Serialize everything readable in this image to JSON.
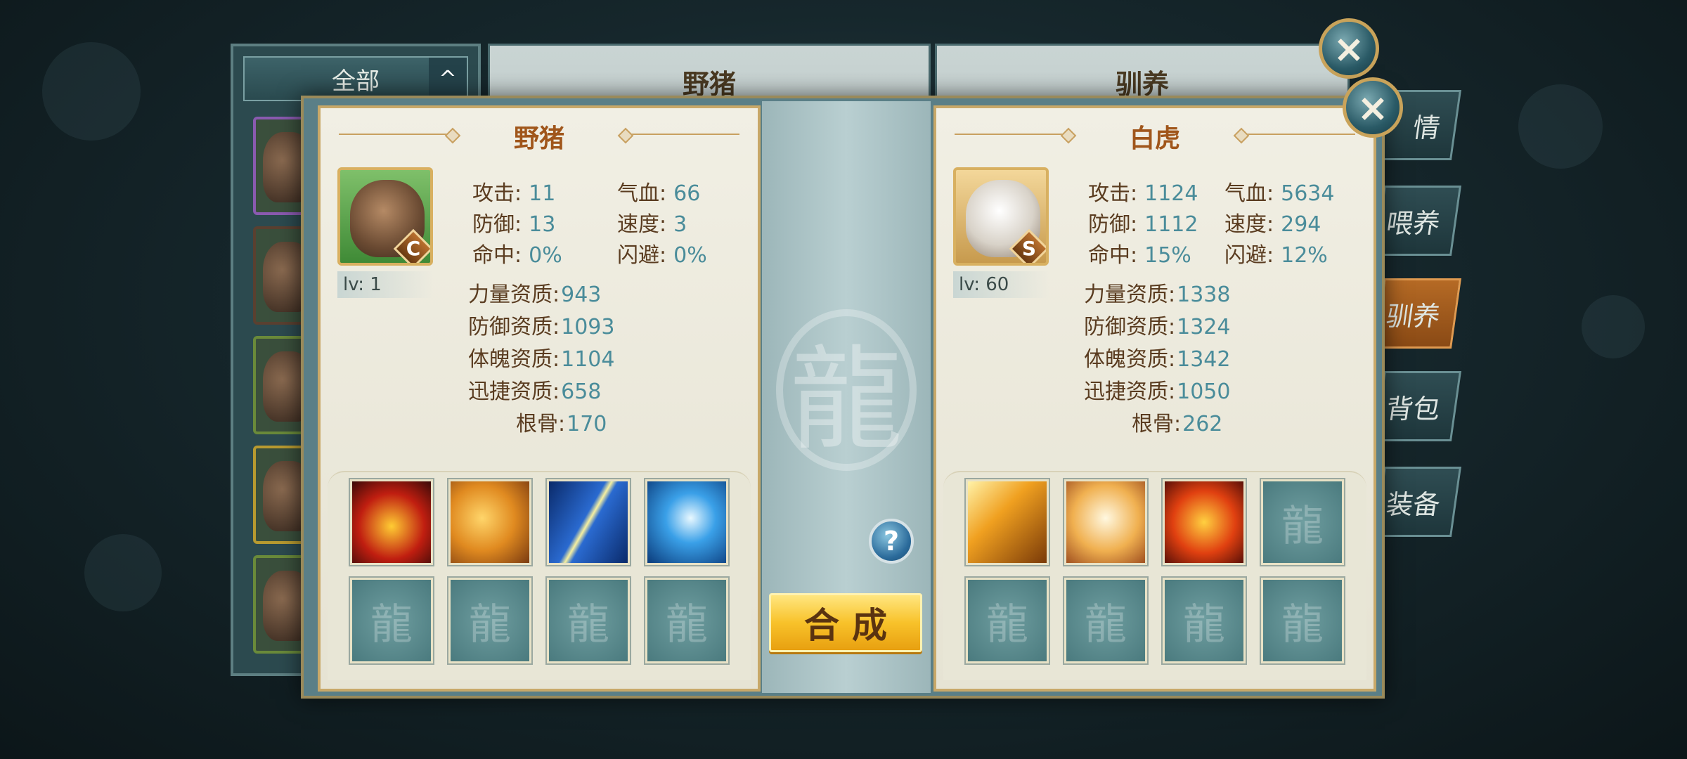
{
  "filter": {
    "label": "全部",
    "arrow": "^"
  },
  "background": {
    "left_title": "野猪",
    "right_title": "驯养"
  },
  "side_tabs": [
    "情",
    "喂养",
    "驯养",
    "背包",
    "装备"
  ],
  "close_icon": "×",
  "left_pet": {
    "name": "野猪",
    "grade": "C",
    "level": "lv: 1",
    "stats": [
      {
        "label": "攻击:",
        "value": "11"
      },
      {
        "label": "气血:",
        "value": "66"
      },
      {
        "label": "防御:",
        "value": "13"
      },
      {
        "label": "速度:",
        "value": "3"
      },
      {
        "label": "命中:",
        "value": "0%"
      },
      {
        "label": "闪避:",
        "value": "0%"
      }
    ],
    "aptitudes": [
      {
        "label": "力量资质:",
        "value": "943"
      },
      {
        "label": "防御资质:",
        "value": "1093"
      },
      {
        "label": "体魄资质:",
        "value": "1104"
      },
      {
        "label": "迅捷资质:",
        "value": "658"
      },
      {
        "label": "根骨:",
        "value": "170"
      }
    ],
    "skills": [
      "fire-ring-skill-icon",
      "roaring-lion-skill-icon",
      "blade-slash-skill-icon",
      "thunder-skill-icon",
      "empty",
      "empty",
      "empty",
      "empty"
    ]
  },
  "right_pet": {
    "name": "白虎",
    "grade": "S",
    "level": "lv: 60",
    "stats": [
      {
        "label": "攻击:",
        "value": "1124"
      },
      {
        "label": "气血:",
        "value": "5634"
      },
      {
        "label": "防御:",
        "value": "1112"
      },
      {
        "label": "速度:",
        "value": "294"
      },
      {
        "label": "命中:",
        "value": "15%"
      },
      {
        "label": "闪避:",
        "value": "12%"
      }
    ],
    "aptitudes": [
      {
        "label": "力量资质:",
        "value": "1338"
      },
      {
        "label": "防御资质:",
        "value": "1324"
      },
      {
        "label": "体魄资质:",
        "value": "1342"
      },
      {
        "label": "迅捷资质:",
        "value": "1050"
      },
      {
        "label": "根骨:",
        "value": "262"
      }
    ],
    "skills": [
      "golden-spear-skill-icon",
      "white-tiger-skill-icon",
      "flame-shield-skill-icon",
      "empty",
      "empty",
      "empty",
      "empty",
      "empty"
    ]
  },
  "help_label": "?",
  "compose_label": "合成",
  "colors": {
    "title": "#a0561b",
    "label": "#5a3c20",
    "value": "#4a8c9a",
    "button": "#f8c22a"
  }
}
